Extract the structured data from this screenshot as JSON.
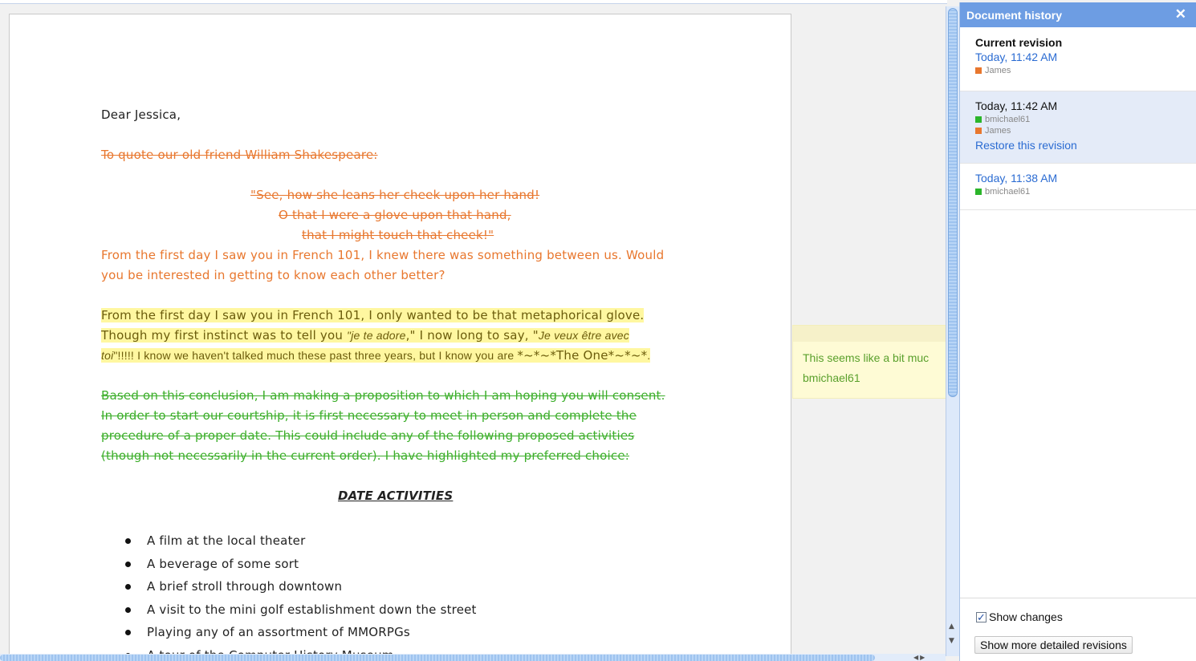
{
  "document": {
    "greeting": "Dear Jessica,",
    "deleted_intro": "To quote our old friend William Shakespeare:",
    "quote_lines": [
      "\"See, how she leans her cheek upon her hand!",
      "O that I were a glove upon that hand,",
      "that I might touch that cheek!\""
    ],
    "inserted_lines": [
      "From the first day I saw you in French 101, I knew there was something between us. Would",
      "you be interested in getting to know each other better?"
    ],
    "highlight": {
      "line1": "From the first day I saw you in French 101, I only wanted to be that metaphorical glove.",
      "line2_a": "Though my first instinct was to tell you ",
      "line2_b": "\"je te adore",
      "line2_c": ",\" I now long to say, \"",
      "line2_d": "Je veux être avec",
      "line3_a": "toi",
      "line3_b": "\"!!!!! I know we haven't talked much these past three years, but I know you are ",
      "line3_c": "*~*~*The One*~*~*",
      "line3_d": "."
    },
    "green_lines": [
      "Based on this conclusion, I am making a proposition to which I am hoping you will consent.",
      "In order to start our courtship, it is first necessary to meet in person and complete the",
      "procedure of a proper date.  This could include any of the following proposed activities",
      "(though not necessarily in the current order). I have highlighted my preferred choice:"
    ],
    "heading": "DATE ACTIVITIES",
    "activities": [
      "A film at the local theater",
      "A beverage of some sort",
      "A brief stroll through downtown",
      "A visit to the mini golf establishment down the street",
      "Playing any of an assortment of MMORPGs",
      "A tour of the Computer History Museum"
    ]
  },
  "comment": {
    "text": "This seems like a bit muc",
    "author": "bmichael61"
  },
  "history": {
    "title": "Document history",
    "close_icon": "close-icon",
    "current": {
      "label": "Current revision",
      "time": "Today, 11:42 AM",
      "authors": [
        {
          "name": "James",
          "color": "#e8772e"
        }
      ]
    },
    "revisions": [
      {
        "time": "Today, 11:42 AM",
        "authors": [
          {
            "name": "bmichael61",
            "color": "#2bb52a"
          },
          {
            "name": "James",
            "color": "#e8772e"
          }
        ],
        "restore": "Restore this revision",
        "selected": true
      },
      {
        "time": "Today, 11:38 AM",
        "authors": [
          {
            "name": "bmichael61",
            "color": "#2bb52a"
          }
        ],
        "selected": false
      }
    ],
    "show_changes": {
      "label": "Show changes",
      "checked": true
    },
    "more_button": "Show more detailed revisions"
  },
  "colors": {
    "panel_header": "#6d9de3",
    "link": "#2a6bd2",
    "james": "#e8772e",
    "bmichael61": "#2bb52a",
    "highlight": "#fff7a0"
  }
}
